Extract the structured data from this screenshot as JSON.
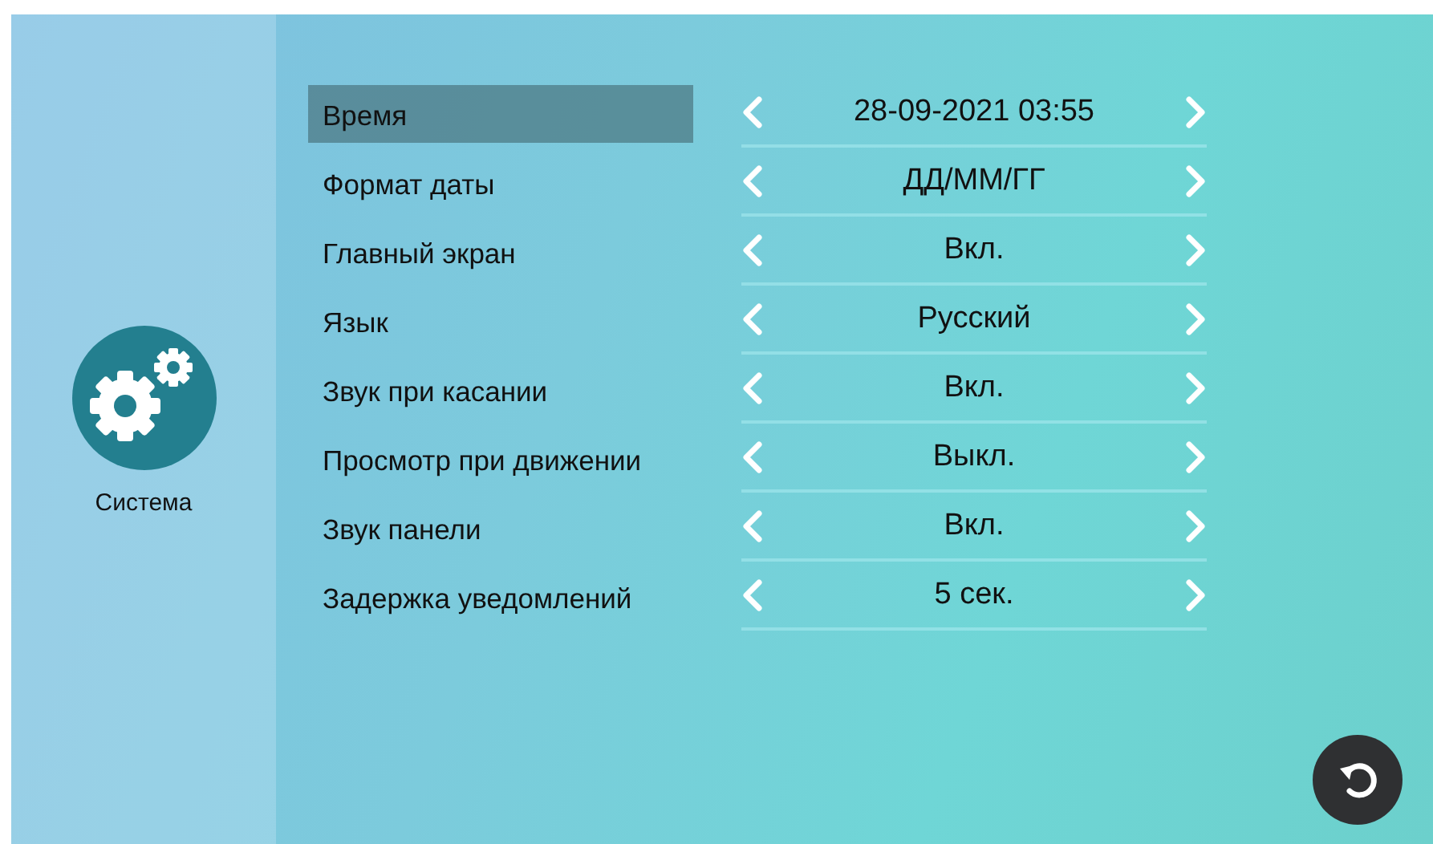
{
  "sidebar": {
    "items": [
      {
        "label": "Система",
        "selected": true
      }
    ]
  },
  "settings": [
    {
      "label": "Время",
      "value": "28-09-2021 03:55",
      "selected": true
    },
    {
      "label": "Формат даты",
      "value": "ДД/ММ/ГГ",
      "selected": false
    },
    {
      "label": "Главный экран",
      "value": "Вкл.",
      "selected": false
    },
    {
      "label": "Язык",
      "value": "Русский",
      "selected": false
    },
    {
      "label": "Звук при касании",
      "value": "Вкл.",
      "selected": false
    },
    {
      "label": "Просмотр при движении",
      "value": "Выкл.",
      "selected": false
    },
    {
      "label": "Звук панели",
      "value": "Вкл.",
      "selected": false
    },
    {
      "label": "Задержка уведомлений",
      "value": "5 сек.",
      "selected": false
    }
  ]
}
